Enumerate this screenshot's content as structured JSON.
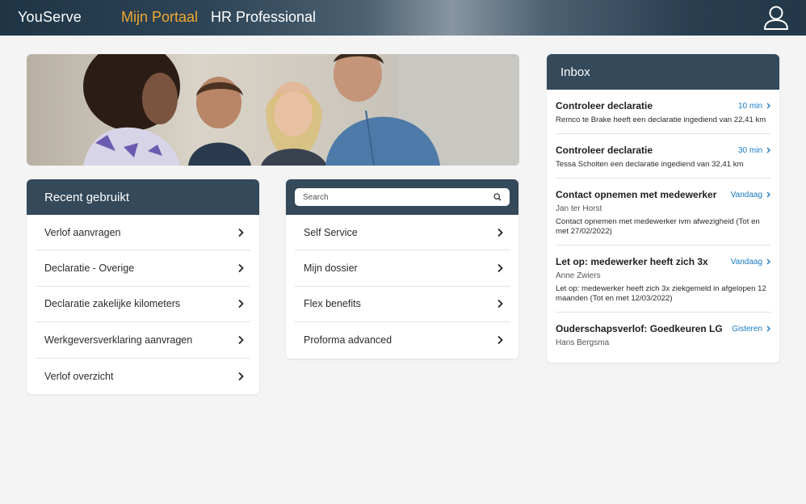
{
  "header": {
    "brand": "YouServe",
    "nav_portal": "Mijn Portaal",
    "nav_hr": "HR Professional",
    "accent_color": "#f0a830"
  },
  "recent": {
    "title": "Recent gebruikt",
    "items": [
      "Verlof aanvragen",
      "Declaratie - Overige",
      "Declaratie zakelijke kilometers",
      "Werkgeversverklaring aanvragen",
      "Verlof overzicht"
    ]
  },
  "service": {
    "search_placeholder": "Search",
    "items": [
      "Self Service",
      "Mijn dossier",
      "Flex benefits",
      "Proforma advanced"
    ]
  },
  "inbox": {
    "title": "Inbox",
    "messages": [
      {
        "title": "Controleer declaratie",
        "time": "10 min",
        "sub": "",
        "body": "Remco te Brake heeft een declaratie ingediend van 22,41 km"
      },
      {
        "title": "Controleer declaratie",
        "time": "30 min",
        "sub": "",
        "body": "Tessa Scholten een declaratie ingediend van 32,41 km"
      },
      {
        "title": "Contact opnemen met medewerker",
        "time": "Vandaag",
        "sub": "Jan ter Horst",
        "body": "Contact opnemen met medewerker ivm afwezigheid (Tot en met 27/02/2022)"
      },
      {
        "title": "Let op: medewerker heeft zich 3x",
        "time": "Vandaag",
        "sub": "Anne Zwiers",
        "body": "Let op: medewerker heeft zich 3x ziekgemeld in afgelopen 12 maanden (Tot en met 12/03/2022)"
      },
      {
        "title": "Ouderschapsverlof: Goedkeuren LG",
        "time": "Gisteren",
        "sub": "Hans Bergsma",
        "body": ""
      }
    ]
  },
  "icons": {
    "user": "user-icon",
    "chevron": "chevron-right-icon",
    "search": "search-icon"
  }
}
